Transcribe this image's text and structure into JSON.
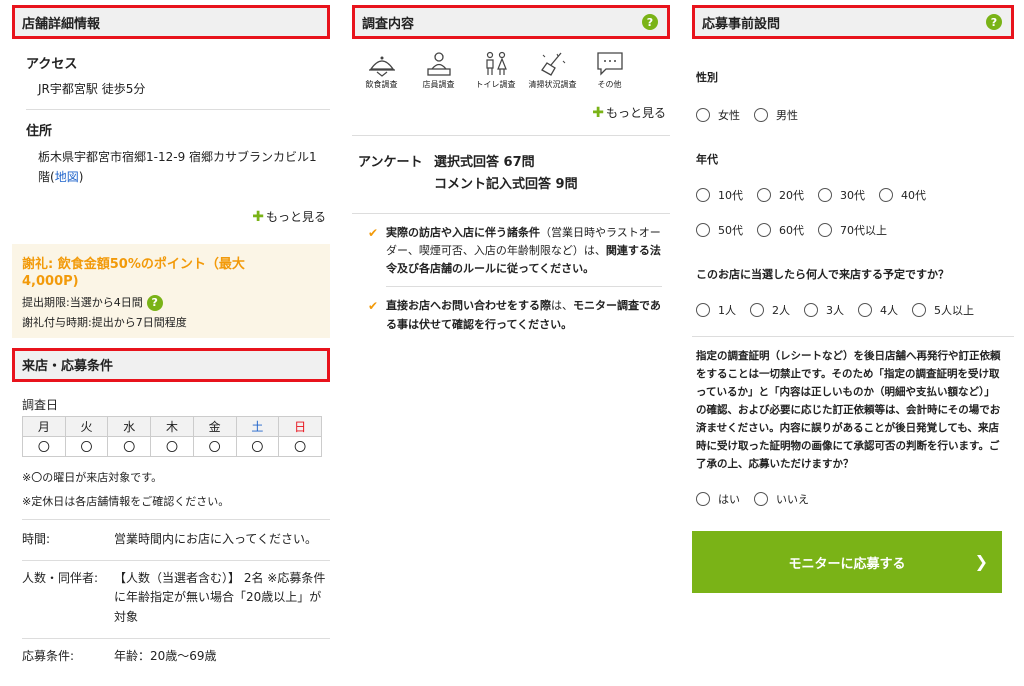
{
  "col1": {
    "store_header": "店舗詳細情報",
    "access_title": "アクセス",
    "access_value": "JR宇都宮駅 徒歩5分",
    "address_title": "住所",
    "address_value": "栃木県宇都宮市宿郷1-12-9 宿郷カサブランカビル1階(",
    "address_map_link": "地図",
    "address_close": ")",
    "more_label": "もっと見る",
    "reward_title": "謝礼: 飲食金額50%のポイント（最大4,000P)",
    "reward_deadline": "提出期限:当選から4日間",
    "reward_grant": "謝礼付与時期:提出から7日間程度",
    "conditions_header": "来店・応募条件",
    "survey_day_label": "調査日",
    "days": [
      "月",
      "火",
      "水",
      "木",
      "金",
      "土",
      "日"
    ],
    "day_marks": [
      "〇",
      "〇",
      "〇",
      "〇",
      "〇",
      "〇",
      "〇"
    ],
    "note1": "※〇の曜日が来店対象です。",
    "note2": "※定休日は各店舗情報をご確認ください。",
    "time_label": "時間:",
    "time_value": "営業時間内にお店に入ってください。",
    "people_label": "人数・同伴者:",
    "people_value": "【人数（当選者含む）】 2名 ※応募条件に年齢指定が無い場合「20歳以上」が対象",
    "apply_cond_label": "応募条件:",
    "apply_cond_value": "年齢：20歳〜69歳"
  },
  "col2": {
    "survey_header": "調査内容",
    "icons": [
      {
        "icon": "food-cloche-icon",
        "label": "飲食調査"
      },
      {
        "icon": "staff-counter-icon",
        "label": "店員調査"
      },
      {
        "icon": "restroom-icon",
        "label": "トイレ調査"
      },
      {
        "icon": "cleaning-icon",
        "label": "清掃状況調査"
      },
      {
        "icon": "speech-bubble-icon",
        "label": "その他"
      }
    ],
    "more_label": "もっと見る",
    "survey_label": "アンケート",
    "survey_choice": "選択式回答 67問",
    "survey_comment": "コメント記入式回答 9問",
    "check1_bold_a": "実際の訪店や入店に伴う諸条件",
    "check1_plain": "（営業日時やラストオーダー、喫煙可否、入店の年齢制限など）は、",
    "check1_bold_b": "関連する法令及び各店舗のルールに従ってください。",
    "check2_bold_a": "直接お店へお問い合わせをする際",
    "check2_plain": "は、",
    "check2_bold_b": "モニター調査である事は伏せて確認を行ってください。"
  },
  "col3": {
    "pre_header": "応募事前設問",
    "q_gender": "性別",
    "gender_opts": [
      "女性",
      "男性"
    ],
    "q_age": "年代",
    "age_opts": [
      "10代",
      "20代",
      "30代",
      "40代",
      "50代",
      "60代",
      "70代以上"
    ],
    "q_party": "このお店に当選したら何人で来店する予定ですか？",
    "party_opts": [
      "1人",
      "2人",
      "3人",
      "4人",
      "5人以上"
    ],
    "notice": "指定の調査証明（レシートなど）を後日店舗へ再発行や訂正依頼をすることは一切禁止です。そのため「指定の調査証明を受け取っているか」と「内容は正しいものか（明細や支払い額など）」の確認、および必要に応じた訂正依頼等は、会計時にその場でお済ませください。内容に誤りがあることが後日発覚しても、来店時に受け取った証明物の画像にて承認可否の判断を行います。ご了承の上、応募いただけますか？",
    "agree_opts": [
      "はい",
      "いいえ"
    ],
    "apply_button": "モニターに応募する"
  },
  "colors": {
    "accent_green": "#7ab317",
    "highlight_red": "#e8131c",
    "reward_orange": "#f29a0a"
  }
}
